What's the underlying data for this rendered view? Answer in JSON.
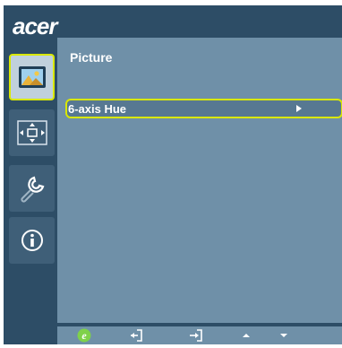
{
  "brand": {
    "logo_text": "acer"
  },
  "sidebar": {
    "items": [
      {
        "icon": "picture-icon",
        "active": true
      },
      {
        "icon": "position-icon",
        "active": false
      },
      {
        "icon": "settings-wrench-icon",
        "active": false
      },
      {
        "icon": "info-icon",
        "active": false
      }
    ]
  },
  "panel": {
    "title": "Picture",
    "items": [
      {
        "label": "6-axis Hue",
        "selected": true,
        "icon": "submenu-arrow-icon"
      }
    ]
  },
  "footer": {
    "buttons": [
      "empowering-icon",
      "enter-icon",
      "exit-icon",
      "up-arrow-icon",
      "down-arrow-icon"
    ]
  },
  "colors": {
    "osd_background": "#2d4d66",
    "panel_background": "#6f90a8",
    "highlight": "#d9e800"
  }
}
